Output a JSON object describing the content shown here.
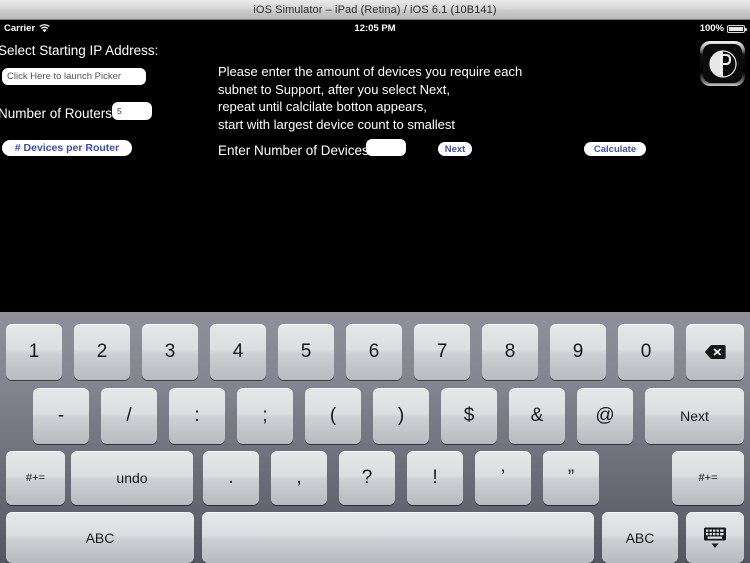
{
  "window": {
    "title": "iOS Simulator – iPad (Retina) / iOS 6.1 (10B141)"
  },
  "status_bar": {
    "carrier": "Carrier",
    "wifi_icon": "wifi-icon",
    "time": "12:05 PM",
    "battery_percent": "100%",
    "battery_icon": "battery-full-icon"
  },
  "app": {
    "app_icon": "app-icon-badge",
    "ip_label": "Select Starting IP Address:",
    "picker_field": {
      "value": "Click Here to launch Picker",
      "placeholder": "Click Here to launch Picker"
    },
    "routers_label": "Number of Routers:",
    "routers_field": {
      "value": "5",
      "placeholder": ""
    },
    "devices_per_router_button": "# Devices per Router",
    "instructions": [
      "Please enter the amount of devices you require each",
      "subnet to Support, after you select Next,",
      "repeat until calcilate botton appears,",
      "start with largest device count to smallest"
    ],
    "enter_devices_label": "Enter Number of Devices:",
    "devices_field": {
      "value": "",
      "placeholder": ""
    },
    "next_button": "Next",
    "calculate_button": "Calculate"
  },
  "keyboard": {
    "row1": [
      {
        "label": "1",
        "name": "key-1"
      },
      {
        "label": "2",
        "name": "key-2"
      },
      {
        "label": "3",
        "name": "key-3"
      },
      {
        "label": "4",
        "name": "key-4"
      },
      {
        "label": "5",
        "name": "key-5"
      },
      {
        "label": "6",
        "name": "key-6"
      },
      {
        "label": "7",
        "name": "key-7"
      },
      {
        "label": "8",
        "name": "key-8"
      },
      {
        "label": "9",
        "name": "key-9"
      },
      {
        "label": "0",
        "name": "key-0"
      },
      {
        "label": "",
        "name": "key-delete"
      }
    ],
    "row2": [
      {
        "label": "-",
        "name": "key-hyphen"
      },
      {
        "label": "/",
        "name": "key-slash"
      },
      {
        "label": ":",
        "name": "key-colon"
      },
      {
        "label": ";",
        "name": "key-semicolon"
      },
      {
        "label": "(",
        "name": "key-paren-open"
      },
      {
        "label": ")",
        "name": "key-paren-close"
      },
      {
        "label": "$",
        "name": "key-dollar"
      },
      {
        "label": "&",
        "name": "key-ampersand"
      },
      {
        "label": "@",
        "name": "key-at"
      },
      {
        "label": "Next",
        "name": "key-next"
      }
    ],
    "row3": [
      {
        "label": "#+=",
        "name": "key-symbols-left"
      },
      {
        "label": "undo",
        "name": "key-undo"
      },
      {
        "label": ".",
        "name": "key-period"
      },
      {
        "label": ",",
        "name": "key-comma"
      },
      {
        "label": "?",
        "name": "key-question"
      },
      {
        "label": "!",
        "name": "key-exclamation"
      },
      {
        "label": "’",
        "name": "key-apostrophe"
      },
      {
        "label": "”",
        "name": "key-quote"
      },
      {
        "label": "#+=",
        "name": "key-symbols-right"
      }
    ],
    "row4": [
      {
        "label": "ABC",
        "name": "key-abc-left"
      },
      {
        "label": "",
        "name": "key-space"
      },
      {
        "label": "ABC",
        "name": "key-abc-right"
      },
      {
        "label": "",
        "name": "key-hide-keyboard"
      }
    ]
  },
  "colors": {
    "accent_blue": "#3b4fb3",
    "app_background": "#000000",
    "keyboard_background": "#6d6e79",
    "key_face": "#dcdde0"
  }
}
